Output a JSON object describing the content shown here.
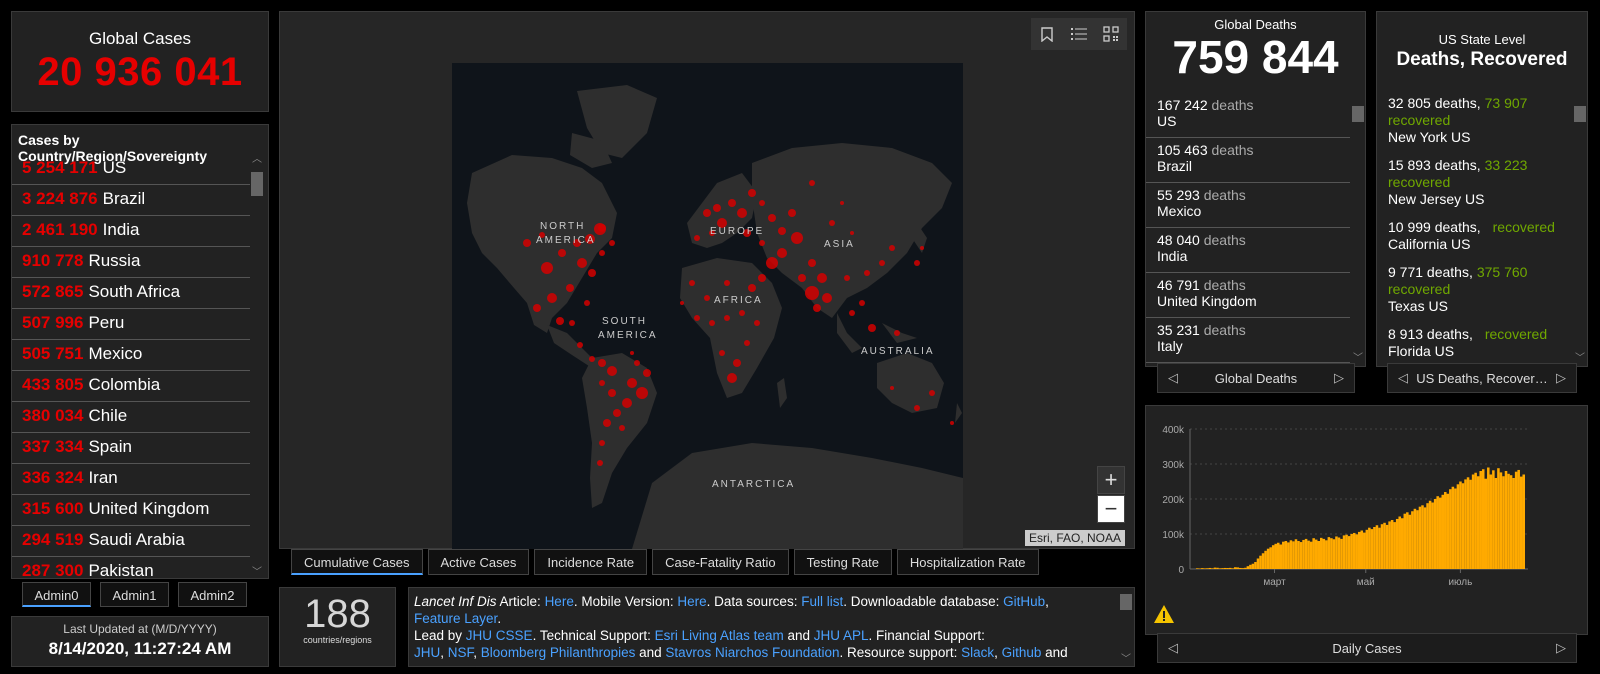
{
  "global_cases": {
    "title": "Global Cases",
    "value": "20 936 041"
  },
  "country_panel": {
    "title": "Cases by Country/Region/Sovereignty",
    "rows": [
      {
        "num": "5 254 171",
        "name": "US"
      },
      {
        "num": "3 224 876",
        "name": "Brazil"
      },
      {
        "num": "2 461 190",
        "name": "India"
      },
      {
        "num": "910 778",
        "name": "Russia"
      },
      {
        "num": "572 865",
        "name": "South Africa"
      },
      {
        "num": "507 996",
        "name": "Peru"
      },
      {
        "num": "505 751",
        "name": "Mexico"
      },
      {
        "num": "433 805",
        "name": "Colombia"
      },
      {
        "num": "380 034",
        "name": "Chile"
      },
      {
        "num": "337 334",
        "name": "Spain"
      },
      {
        "num": "336 324",
        "name": "Iran"
      },
      {
        "num": "315 600",
        "name": "United Kingdom"
      },
      {
        "num": "294 519",
        "name": "Saudi Arabia"
      },
      {
        "num": "287 300",
        "name": "Pakistan"
      }
    ]
  },
  "admin_tabs": [
    "Admin0",
    "Admin1",
    "Admin2"
  ],
  "last_updated": {
    "label": "Last Updated at (M/D/YYYY)",
    "value": "8/14/2020, 11:27:24 AM"
  },
  "map": {
    "labels": [
      "NORTH",
      "AMERICA",
      "EUROPE",
      "ASIA",
      "AFRICA",
      "SOUTH",
      "AMERICA",
      "AUSTRALIA",
      "ANTARCTICA"
    ],
    "attribution": "Esri, FAO, NOAA",
    "zoom_in": "+",
    "zoom_out": "−",
    "tools": [
      "bookmark-icon",
      "legend-list-icon",
      "qr-grid-icon"
    ]
  },
  "map_tabs": [
    "Cumulative Cases",
    "Active Cases",
    "Incidence Rate",
    "Case-Fatality Ratio",
    "Testing Rate",
    "Hospitalization Rate"
  ],
  "country_count": {
    "value": "188",
    "label": "countries/regions"
  },
  "info": {
    "t1": "Lancet Inf Dis",
    "t2": " Article: ",
    "l_here1": "Here",
    "t3": ". Mobile Version: ",
    "l_here2": "Here",
    "t4": ". Data sources: ",
    "l_full": "Full list",
    "t5": ". Downloadable database: ",
    "l_github": "GitHub",
    "t6": ", ",
    "l_feature": "Feature Layer",
    "t7": ".",
    "t8": "Lead by ",
    "l_jhucsse": "JHU CSSE",
    "t9": ". Technical Support: ",
    "l_esri": "Esri Living Atlas team",
    "t10": " and ",
    "l_apl": "JHU APL",
    "t11": ". Financial Support:",
    "l_jhu": "JHU",
    "t12": ", ",
    "l_nsf": "NSF",
    "t13": ", ",
    "l_bloomberg": "Bloomberg Philanthropies",
    "t14": " and ",
    "l_stavros": "Stavros Niarchos Foundation",
    "t15": ". Resource support: ",
    "l_slack": "Slack",
    "t16": ", ",
    "l_github2": "Github",
    "t17": " and"
  },
  "deaths_panel": {
    "title": "Global Deaths",
    "value": "759 844",
    "word": "deaths",
    "rows": [
      {
        "num": "167 242",
        "name": "US"
      },
      {
        "num": "105 463",
        "name": "Brazil"
      },
      {
        "num": "55 293",
        "name": "Mexico"
      },
      {
        "num": "48 040",
        "name": "India"
      },
      {
        "num": "46 791",
        "name": "United Kingdom"
      },
      {
        "num": "35 231",
        "name": "Italy"
      }
    ],
    "pager_label": "Global Deaths"
  },
  "state_panel": {
    "title1": "US State Level",
    "title2": "Deaths, Recovered",
    "rows": [
      {
        "deaths": "32 805 deaths,",
        "rec_num": "73 907",
        "rec_word": "recovered",
        "name": "New York US"
      },
      {
        "deaths": "15 893 deaths,",
        "rec_num": "33 223",
        "rec_word": "recovered",
        "name": "New Jersey US"
      },
      {
        "deaths": "10 999 deaths,",
        "rec_num": "",
        "rec_word": "recovered",
        "name": "California US"
      },
      {
        "deaths": "9 771 deaths,",
        "rec_num": "375 760",
        "rec_word": "recovered",
        "name": "Texas US"
      },
      {
        "deaths": "8 913 deaths,",
        "rec_num": "",
        "rec_word": "recovered",
        "name": "Florida US"
      }
    ],
    "pager_label": "US Deaths, Recover…"
  },
  "chart_pager_label": "Daily Cases",
  "chart_data": {
    "type": "bar",
    "title": "",
    "xlabel": "",
    "ylabel": "",
    "ylim": [
      0,
      400000
    ],
    "yticks": [
      "0",
      "100k",
      "200k",
      "300k",
      "400k"
    ],
    "xticks": [
      "март",
      "май",
      "июль"
    ],
    "color": "#ffaa00",
    "series": [
      {
        "values": [
          2000,
          1500,
          2500,
          1800,
          2200,
          3000,
          2000,
          4000,
          3500,
          2000,
          2500,
          3000,
          2800,
          3200,
          2000,
          5000,
          4500,
          3000,
          2500,
          3500,
          8000,
          12000,
          15000,
          20000,
          30000,
          38000,
          45000,
          52000,
          58000,
          62000,
          68000,
          72000,
          75000,
          70000,
          78000,
          80000,
          76000,
          82000,
          79000,
          85000,
          80000,
          77000,
          83000,
          86000,
          81000,
          78000,
          88000,
          84000,
          80000,
          89000,
          86000,
          82000,
          91000,
          88000,
          85000,
          93000,
          90000,
          86000,
          96000,
          98000,
          94000,
          100000,
          103000,
          99000,
          106000,
          110000,
          104000,
          112000,
          118000,
          114000,
          120000,
          125000,
          118000,
          128000,
          132000,
          126000,
          136000,
          140000,
          134000,
          143000,
          150000,
          145000,
          158000,
          162000,
          155000,
          165000,
          172000,
          168000,
          178000,
          182000,
          176000,
          188000,
          195000,
          190000,
          200000,
          208000,
          204000,
          212000,
          220000,
          215000,
          228000,
          235000,
          230000,
          242000,
          250000,
          245000,
          256000,
          262000,
          255000,
          270000,
          275000,
          265000,
          280000,
          285000,
          258000,
          290000,
          270000,
          282000,
          260000,
          288000,
          276000,
          265000,
          280000,
          272000,
          268000,
          260000,
          278000,
          283000,
          264000,
          270000
        ]
      }
    ]
  }
}
